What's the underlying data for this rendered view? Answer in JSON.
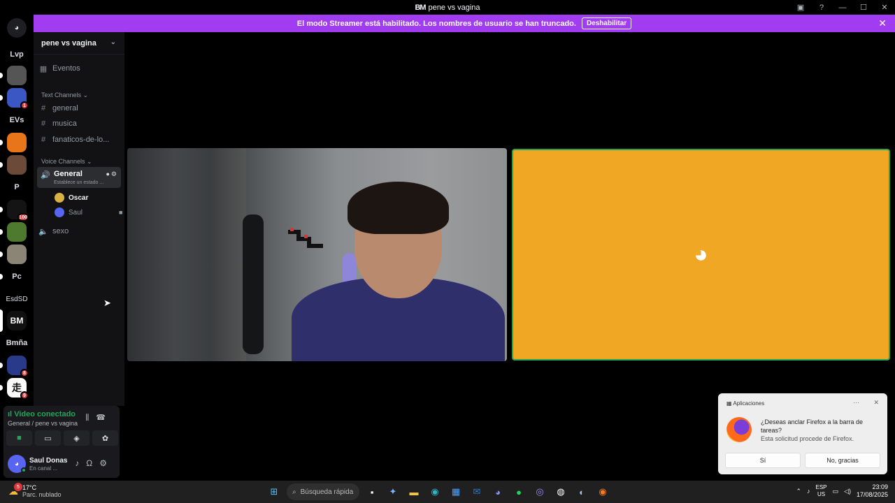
{
  "window": {
    "title": "pene vs vagina",
    "logo_text": "BM"
  },
  "streamer_banner": {
    "message": "El modo Streamer está habilitado. Los nombres de usuario se han truncado.",
    "disable_label": "Deshabilitar"
  },
  "servers": [
    {
      "label": "Lvp"
    },
    {
      "label": "EVs"
    },
    {
      "label": "P"
    },
    {
      "label": "Pc"
    },
    {
      "label": "EsdSD"
    },
    {
      "label": "Bmña"
    }
  ],
  "server_badges": {
    "qu": "1",
    "cooper": "100",
    "s8": "8",
    "s9": "9"
  },
  "sidebar": {
    "guild_name": "pene vs vagina",
    "events_label": "Eventos",
    "text_category": "Text Channels",
    "text_channels": [
      "general",
      "musica",
      "fanaticos-de-lo..."
    ],
    "voice_category": "Voice Channels",
    "active_voice": {
      "name": "General",
      "status": "Establece un estado ..."
    },
    "voice_users": [
      "Oscar",
      "Saul"
    ],
    "other_voice": "sexo"
  },
  "voice_panel": {
    "status": "Video conectado",
    "channel": "General / pene vs vagina"
  },
  "user_panel": {
    "name": "Saul Donas",
    "status": "En canal ..."
  },
  "toast": {
    "app": "Aplicaciones",
    "question": "¿Deseas anclar Firefox a la barra de tareas?",
    "source": "Esta solicitud procede de Firefox.",
    "yes": "Sí",
    "no": "No, gracias"
  },
  "taskbar": {
    "temp": "17°C",
    "weather": "Parc. nublado",
    "weather_badge": "5",
    "search_placeholder": "Búsqueda rápida",
    "lang_top": "ESP",
    "lang_bottom": "US",
    "time": "23:09",
    "date": "17/08/2025"
  },
  "colors": {
    "accent": "#5865f2",
    "banner": "#a13cf0",
    "connected": "#23a55a",
    "avatar_tile": "#f0a723"
  }
}
